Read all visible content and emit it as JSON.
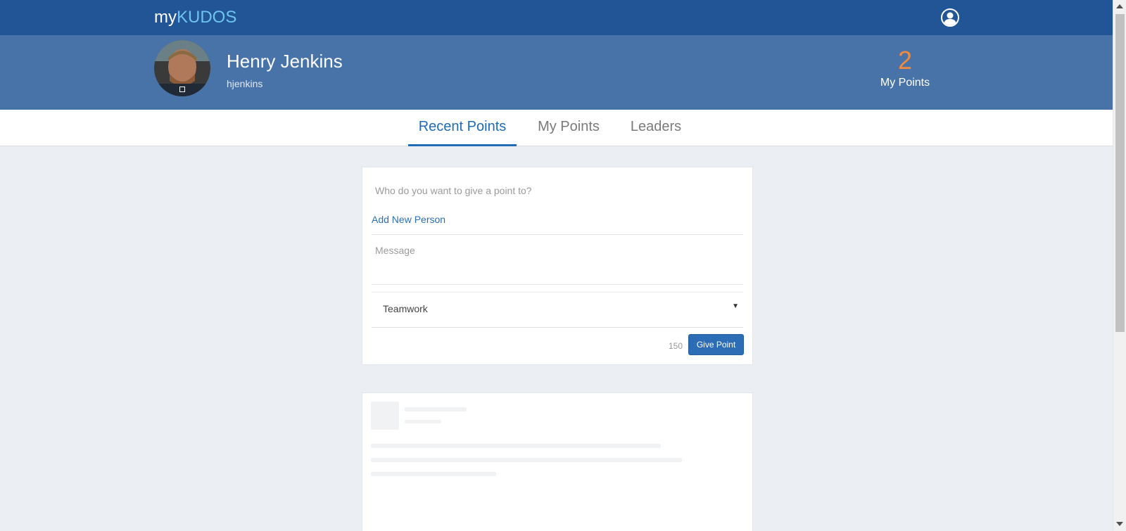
{
  "header": {
    "logo_my": "my",
    "logo_kudos": "KUDOS",
    "user_icon": "user-circle-icon"
  },
  "profile": {
    "name": "Henry Jenkins",
    "username": "hjenkins",
    "points": "2",
    "points_label": "My Points"
  },
  "tabs": [
    {
      "label": "Recent Points",
      "active": true
    },
    {
      "label": "My Points",
      "active": false
    },
    {
      "label": "Leaders",
      "active": false
    }
  ],
  "give_form": {
    "recipient_placeholder": "Who do you want to give a point to?",
    "add_person_link": "Add New Person",
    "message_placeholder": "Message",
    "category_selected": "Teamwork",
    "char_count": "150",
    "submit_label": "Give Point"
  },
  "colors": {
    "topbar": "#225596",
    "profilebar": "#4873a9",
    "accent": "#1f6bb5",
    "points": "#f08a3c",
    "logo_kudos": "#6ec4f0"
  }
}
